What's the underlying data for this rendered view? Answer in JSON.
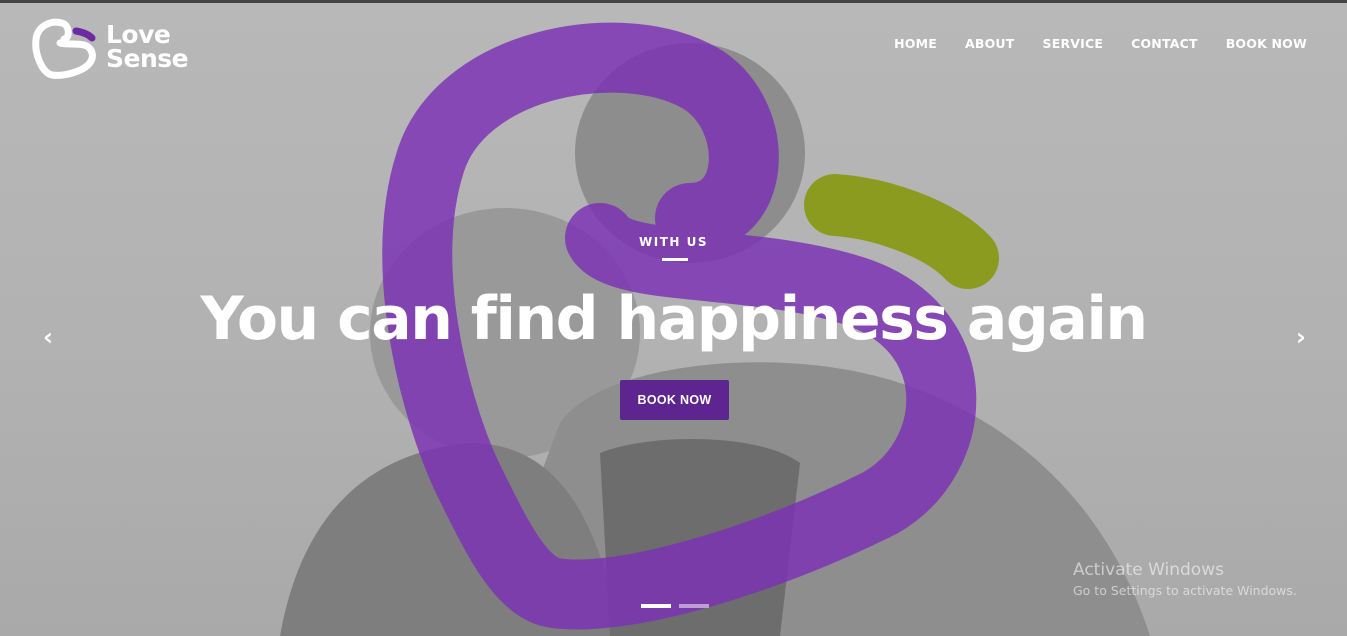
{
  "brand": {
    "name_line1": "Love",
    "name_line2": "Sense",
    "logo_icon": "heart-s-logo-icon",
    "accent_color": "#5e2590"
  },
  "nav": {
    "items": [
      {
        "label": "HOME"
      },
      {
        "label": "ABOUT"
      },
      {
        "label": "SERVICE"
      },
      {
        "label": "CONTACT"
      },
      {
        "label": "BOOK NOW"
      }
    ]
  },
  "hero": {
    "eyebrow": "WITH US",
    "headline": "You can find happiness again",
    "cta_label": "BOOK NOW",
    "prev_icon": "chevron-left-icon",
    "next_icon": "chevron-right-icon",
    "prev_glyph": "‹",
    "next_glyph": "›",
    "slide_count": 2,
    "active_slide": 1,
    "colors": {
      "purple": "#7a2fb5",
      "green": "#8a9b1f"
    }
  },
  "watermark": {
    "title": "Activate Windows",
    "subtitle": "Go to Settings to activate Windows."
  }
}
